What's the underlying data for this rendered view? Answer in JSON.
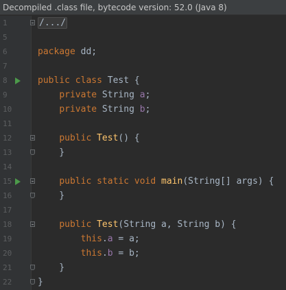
{
  "banner": "Decompiled .class file, bytecode version: 52.0 (Java 8)",
  "lines": [
    {
      "num": "1",
      "code": "/.../"
    },
    {
      "num": "5",
      "code": ""
    },
    {
      "num": "6",
      "code": "package dd;"
    },
    {
      "num": "7",
      "code": ""
    },
    {
      "num": "8",
      "code": "public class Test {"
    },
    {
      "num": "9",
      "code": "    private String a;"
    },
    {
      "num": "10",
      "code": "    private String b;"
    },
    {
      "num": "11",
      "code": ""
    },
    {
      "num": "12",
      "code": "    public Test() {"
    },
    {
      "num": "13",
      "code": "    }"
    },
    {
      "num": "14",
      "code": ""
    },
    {
      "num": "15",
      "code": "    public static void main(String[] args) {"
    },
    {
      "num": "16",
      "code": "    }"
    },
    {
      "num": "17",
      "code": ""
    },
    {
      "num": "18",
      "code": "    public Test(String a, String b) {"
    },
    {
      "num": "19",
      "code": "        this.a = a;"
    },
    {
      "num": "20",
      "code": "        this.b = b;"
    },
    {
      "num": "21",
      "code": "    }"
    },
    {
      "num": "22",
      "code": "}"
    }
  ],
  "tokens": {
    "l1": {
      "fold": "/.../"
    },
    "l6": {
      "kw": "package",
      "rest": " dd;"
    },
    "l8": {
      "kw": "public class",
      "rest": " Test {"
    },
    "l9": {
      "indent": "    ",
      "kw": "private",
      "rest": " String ",
      "fld": "a",
      "end": ";"
    },
    "l10": {
      "indent": "    ",
      "kw": "private",
      "rest": " String ",
      "fld": "b",
      "end": ";"
    },
    "l12": {
      "indent": "    ",
      "kw": "public",
      "sp": " ",
      "fn": "Test",
      "end": "() {"
    },
    "l13": {
      "text": "    }"
    },
    "l15": {
      "indent": "    ",
      "kw": "public static void",
      "sp": " ",
      "fn": "main",
      "end": "(String[] args) {"
    },
    "l16": {
      "text": "    }"
    },
    "l18": {
      "indent": "    ",
      "kw": "public",
      "sp": " ",
      "fn": "Test",
      "end": "(String a, String b) {"
    },
    "l19": {
      "indent": "        ",
      "kw": "this",
      "dot": ".",
      "fld": "a",
      "end": " = a;"
    },
    "l20": {
      "indent": "        ",
      "kw": "this",
      "dot": ".",
      "fld": "b",
      "end": " = b;"
    },
    "l21": {
      "text": "    }"
    },
    "l22": {
      "text": "}"
    }
  }
}
